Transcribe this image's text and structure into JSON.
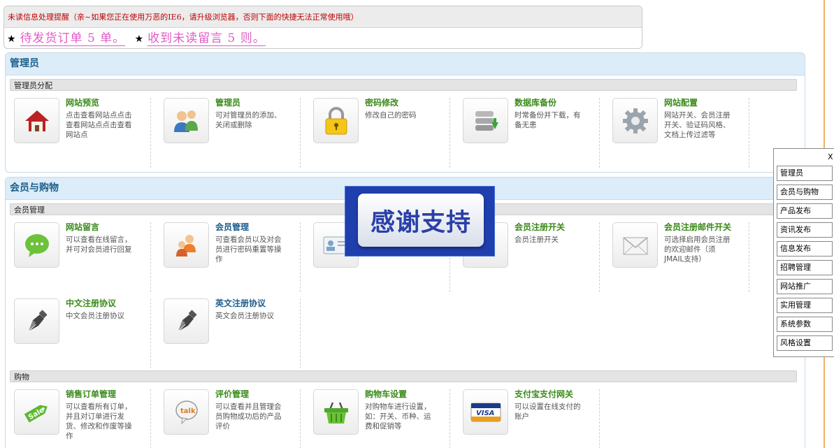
{
  "notice": {
    "header": "未读信息处理提醒（亲~如果您正在使用万恶的IE6，请升级浏览器，否则下面的快捷无法正常使用哦）",
    "star": "★",
    "pending_orders": "待发货订单 5 单。",
    "unread_messages": "收到未读留言 5 则。"
  },
  "sections": {
    "admin": {
      "title": "管理员",
      "subtitle": "管理员分配",
      "cards": [
        {
          "title": "网站预览",
          "desc": "点击查看网站点点击查看网站点点击查看网站点",
          "icon": "house-icon"
        },
        {
          "title": "管理员",
          "desc": "可对管理员的添加、关闭或删除",
          "icon": "users-icon"
        },
        {
          "title": "密码修改",
          "desc": "修改自己的密码",
          "icon": "lock-icon"
        },
        {
          "title": "数据库备份",
          "desc": "时常备份并下载，有备无患",
          "icon": "database-icon"
        },
        {
          "title": "网站配置",
          "desc": "网站开关、会员注册开关、验证码风格、文档上传过滤等",
          "icon": "gear-icon"
        }
      ]
    },
    "member": {
      "title": "会员与购物",
      "subtitle_member": "会员管理",
      "subtitle_shop": "购物",
      "member_cards": [
        {
          "title": "网站留言",
          "desc": "可以查看在线留言，并可对会员进行回复",
          "icon": "chat-icon"
        },
        {
          "title": "会员管理",
          "desc": "可查看会员以及对会员进行密码重置等操作",
          "icon": "members-icon"
        },
        {
          "title": "",
          "desc": "",
          "icon": "id-card-icon"
        },
        {
          "title": "会员注册开关",
          "desc": "会员注册开关",
          "icon": "switch-icon"
        },
        {
          "title": "会员注册邮件开关",
          "desc": "可选择启用会员注册的欢迎邮件（须JMAIL支持）",
          "icon": "mail-icon"
        },
        {
          "title": "中文注册协议",
          "desc": "中文会员注册协议",
          "icon": "pen-icon"
        },
        {
          "title": "英文注册协议",
          "desc": "英文会员注册协议",
          "icon": "pen-icon"
        }
      ],
      "shop_cards": [
        {
          "title": "销售订单管理",
          "desc": "可以查看所有订单，并且对订单进行发货、修改和作废等操作",
          "icon": "sale-tag-icon"
        },
        {
          "title": "评价管理",
          "desc": "可以查看并且管理会员购物成功后的产品评价",
          "icon": "talk-icon"
        },
        {
          "title": "购物车设置",
          "desc": "对购物车进行设置，如：开关、币种、运费和促销等",
          "icon": "basket-icon"
        },
        {
          "title": "支付宝支付网关",
          "desc": "可以设置在线支付的账户",
          "icon": "visa-icon"
        }
      ]
    }
  },
  "popup": {
    "text": "感谢支持"
  },
  "side_menu": {
    "close": "X",
    "items": [
      "管理员",
      "会员与购物",
      "产品发布",
      "资讯发布",
      "信息发布",
      "招聘管理",
      "网站推广",
      "实用管理",
      "系统参数",
      "风格设置"
    ]
  },
  "colors": {
    "accent_green": "#3a8a1a",
    "accent_blue": "#1e5d8c",
    "notice_pink": "#e05bc8",
    "notice_red": "#c00000"
  }
}
